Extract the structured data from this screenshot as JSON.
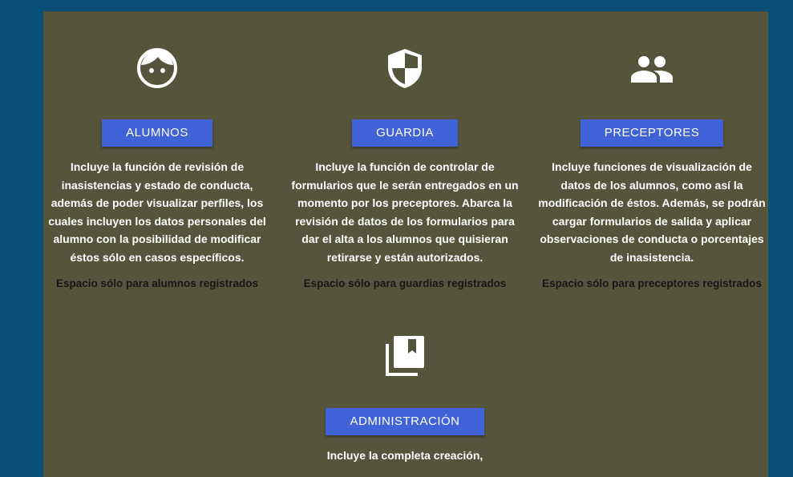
{
  "cards": [
    {
      "button": "ALUMNOS",
      "description": "Incluye la función de revisión de inasistencias y estado de conducta, además de poder visualizar perfiles, los cuales incluyen los datos personales del alumno con la posibilidad de modificar éstos sólo en casos específicos.",
      "note": "Espacio sólo para alumnos registrados",
      "icon": "face-icon"
    },
    {
      "button": "GUARDIA",
      "description": "Incluye la función de controlar de formularios que le serán entregados en un momento por los preceptores. Abarca la revisión de datos de los formularios para dar el alta a los alumnos que quisieran retirarse y están autorizados.",
      "note": "Espacio sólo para guardias registrados",
      "icon": "shield-icon"
    },
    {
      "button": "PRECEPTORES",
      "description": "Incluye funciones de visualización de datos de los alumnos, como así la modificación de éstos. Además, se podrán cargar formularios de salida y aplicar observaciones de conducta o porcentajes de inasistencia.",
      "note": "Espacio sólo para preceptores registrados",
      "icon": "people-icon"
    },
    {
      "button": "ADMINISTRACIÓN",
      "description": "Incluye la completa creación,",
      "icon": "bookmarks-icon"
    }
  ],
  "colors": {
    "page_bg": "#0b5077",
    "panel_bg": "#55553c",
    "button_bg": "#3f63d6"
  }
}
